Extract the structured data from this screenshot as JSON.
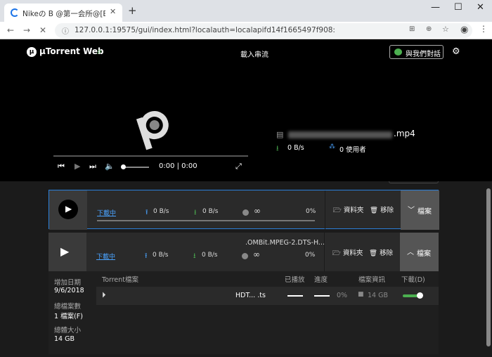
{
  "browser": {
    "tab_title": "Nikeの B @第一会所@[BumsBu",
    "new_tab": "+",
    "url": "127.0.0.1:19575/gui/index.html?localauth=localapifd14f1665497f908:",
    "controls": {
      "minimize": "—",
      "maximize": "☐",
      "close": "✕"
    }
  },
  "app": {
    "logo_text": "µTorrent Web",
    "header_title": "載入串流",
    "chat_button": "與我們對話",
    "now_playing": {
      "filename_suffix": ".mp4",
      "download_speed": "0 B/s",
      "peers": "0 使用者"
    },
    "player": {
      "time": "0:00 | 0:00"
    },
    "torrents": [
      {
        "status": "下載中",
        "upload": "0 B/s",
        "download": "0 B/s",
        "infinity": "∞",
        "percent": "0%",
        "folder_btn": "資料夾",
        "remove_btn": "移除",
        "files_btn": "檔案",
        "files_chev": "﹀"
      },
      {
        "name": ".OMBit.MPEG-2.DTS-H...",
        "status": "下載中",
        "upload": "0 B/s",
        "download": "0 B/s",
        "infinity": "∞",
        "percent": "0%",
        "folder_btn": "資料夾",
        "remove_btn": "移除",
        "files_btn": "檔案",
        "files_chev": "︿"
      }
    ],
    "details": {
      "added_label": "增加日期",
      "added_value": "9/6/2018",
      "total_files_label": "總檔案數",
      "total_files_value": "1 檔案(F)",
      "total_size_label": "總體大小",
      "total_size_value": "14 GB",
      "columns": [
        "Torrent檔案",
        "已播放",
        "進度",
        "檔案資訊",
        "下載(D)"
      ],
      "file_row": {
        "name": "HDT...  .ts",
        "progress": "0%",
        "size": "14 GB"
      }
    }
  }
}
